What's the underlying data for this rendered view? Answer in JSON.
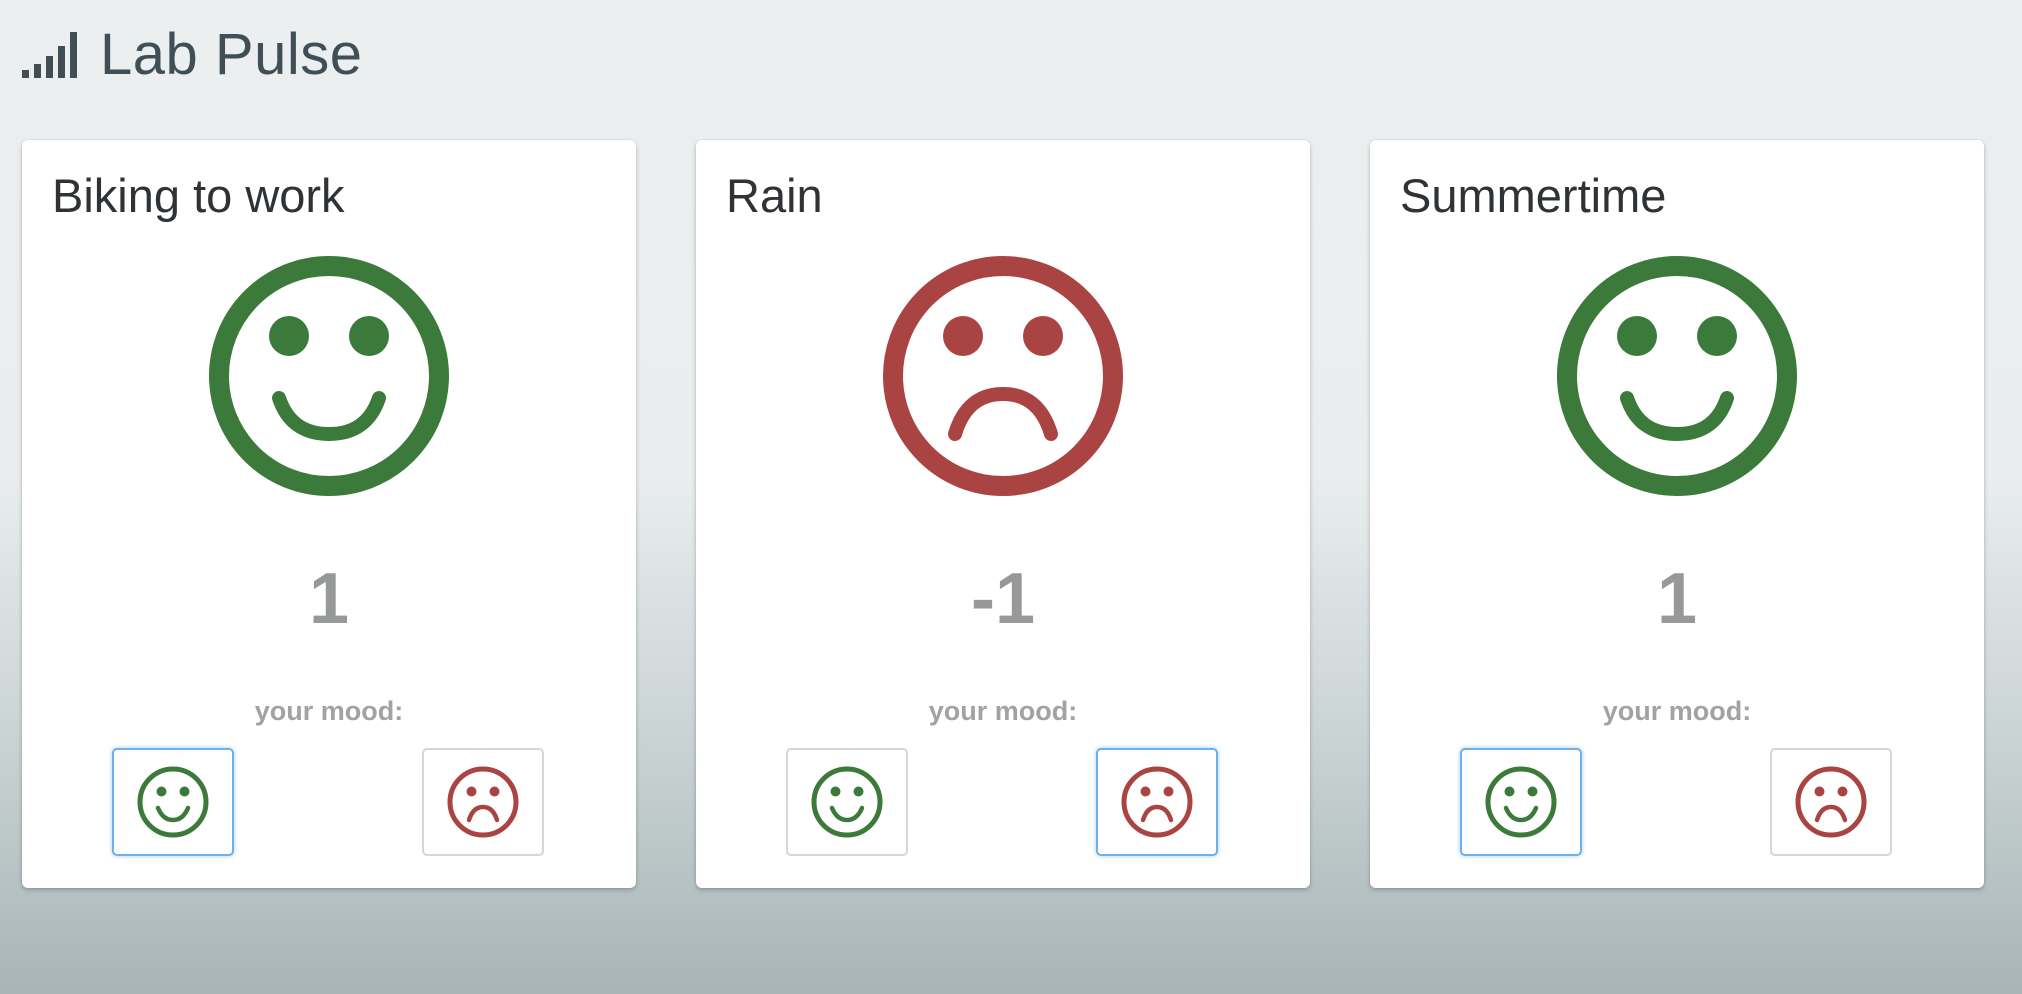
{
  "app": {
    "title": "Lab Pulse",
    "logo_icon": "signal-bars-icon"
  },
  "colors": {
    "happy": "#3b7a3b",
    "sad": "#a94442",
    "score": "#969899",
    "selected_border": "#6fb1e8"
  },
  "cards": [
    {
      "title": "Biking to work",
      "score": "1",
      "mood": "happy",
      "mood_label": "your mood:",
      "selected_vote": "happy"
    },
    {
      "title": "Rain",
      "score": "-1",
      "mood": "sad",
      "mood_label": "your mood:",
      "selected_vote": "sad"
    },
    {
      "title": "Summertime",
      "score": "1",
      "mood": "happy",
      "mood_label": "your mood:",
      "selected_vote": "happy"
    }
  ]
}
